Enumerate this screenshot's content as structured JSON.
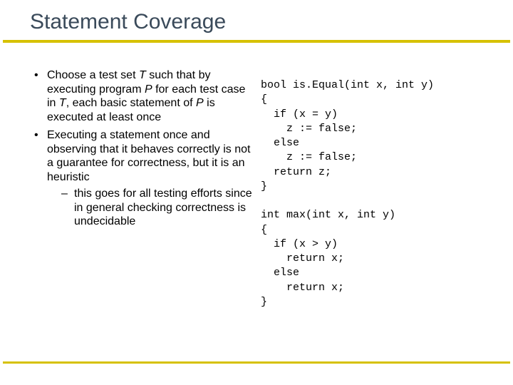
{
  "title": "Statement Coverage",
  "bullets": {
    "b1": {
      "pre1": "Choose a test set ",
      "i1": "T",
      "mid1": " such that by executing program ",
      "i2": "P",
      "mid2": " for each test case in ",
      "i3": "T",
      "mid3": ", each basic statement of ",
      "i4": "P",
      "post": " is executed at least once"
    },
    "b2": {
      "text": "Executing a statement once and observing that it behaves correctly is not a guarantee for correctness, but it is an heuristic",
      "sub1": "this goes for all testing efforts since in general checking correctness is undecidable"
    }
  },
  "code": "bool is.Equal(int x, int y)\n{\n  if (x = y)\n    z := false;\n  else\n    z := false;\n  return z;\n}\n\nint max(int x, int y)\n{\n  if (x > y)\n    return x;\n  else\n    return x;\n}"
}
